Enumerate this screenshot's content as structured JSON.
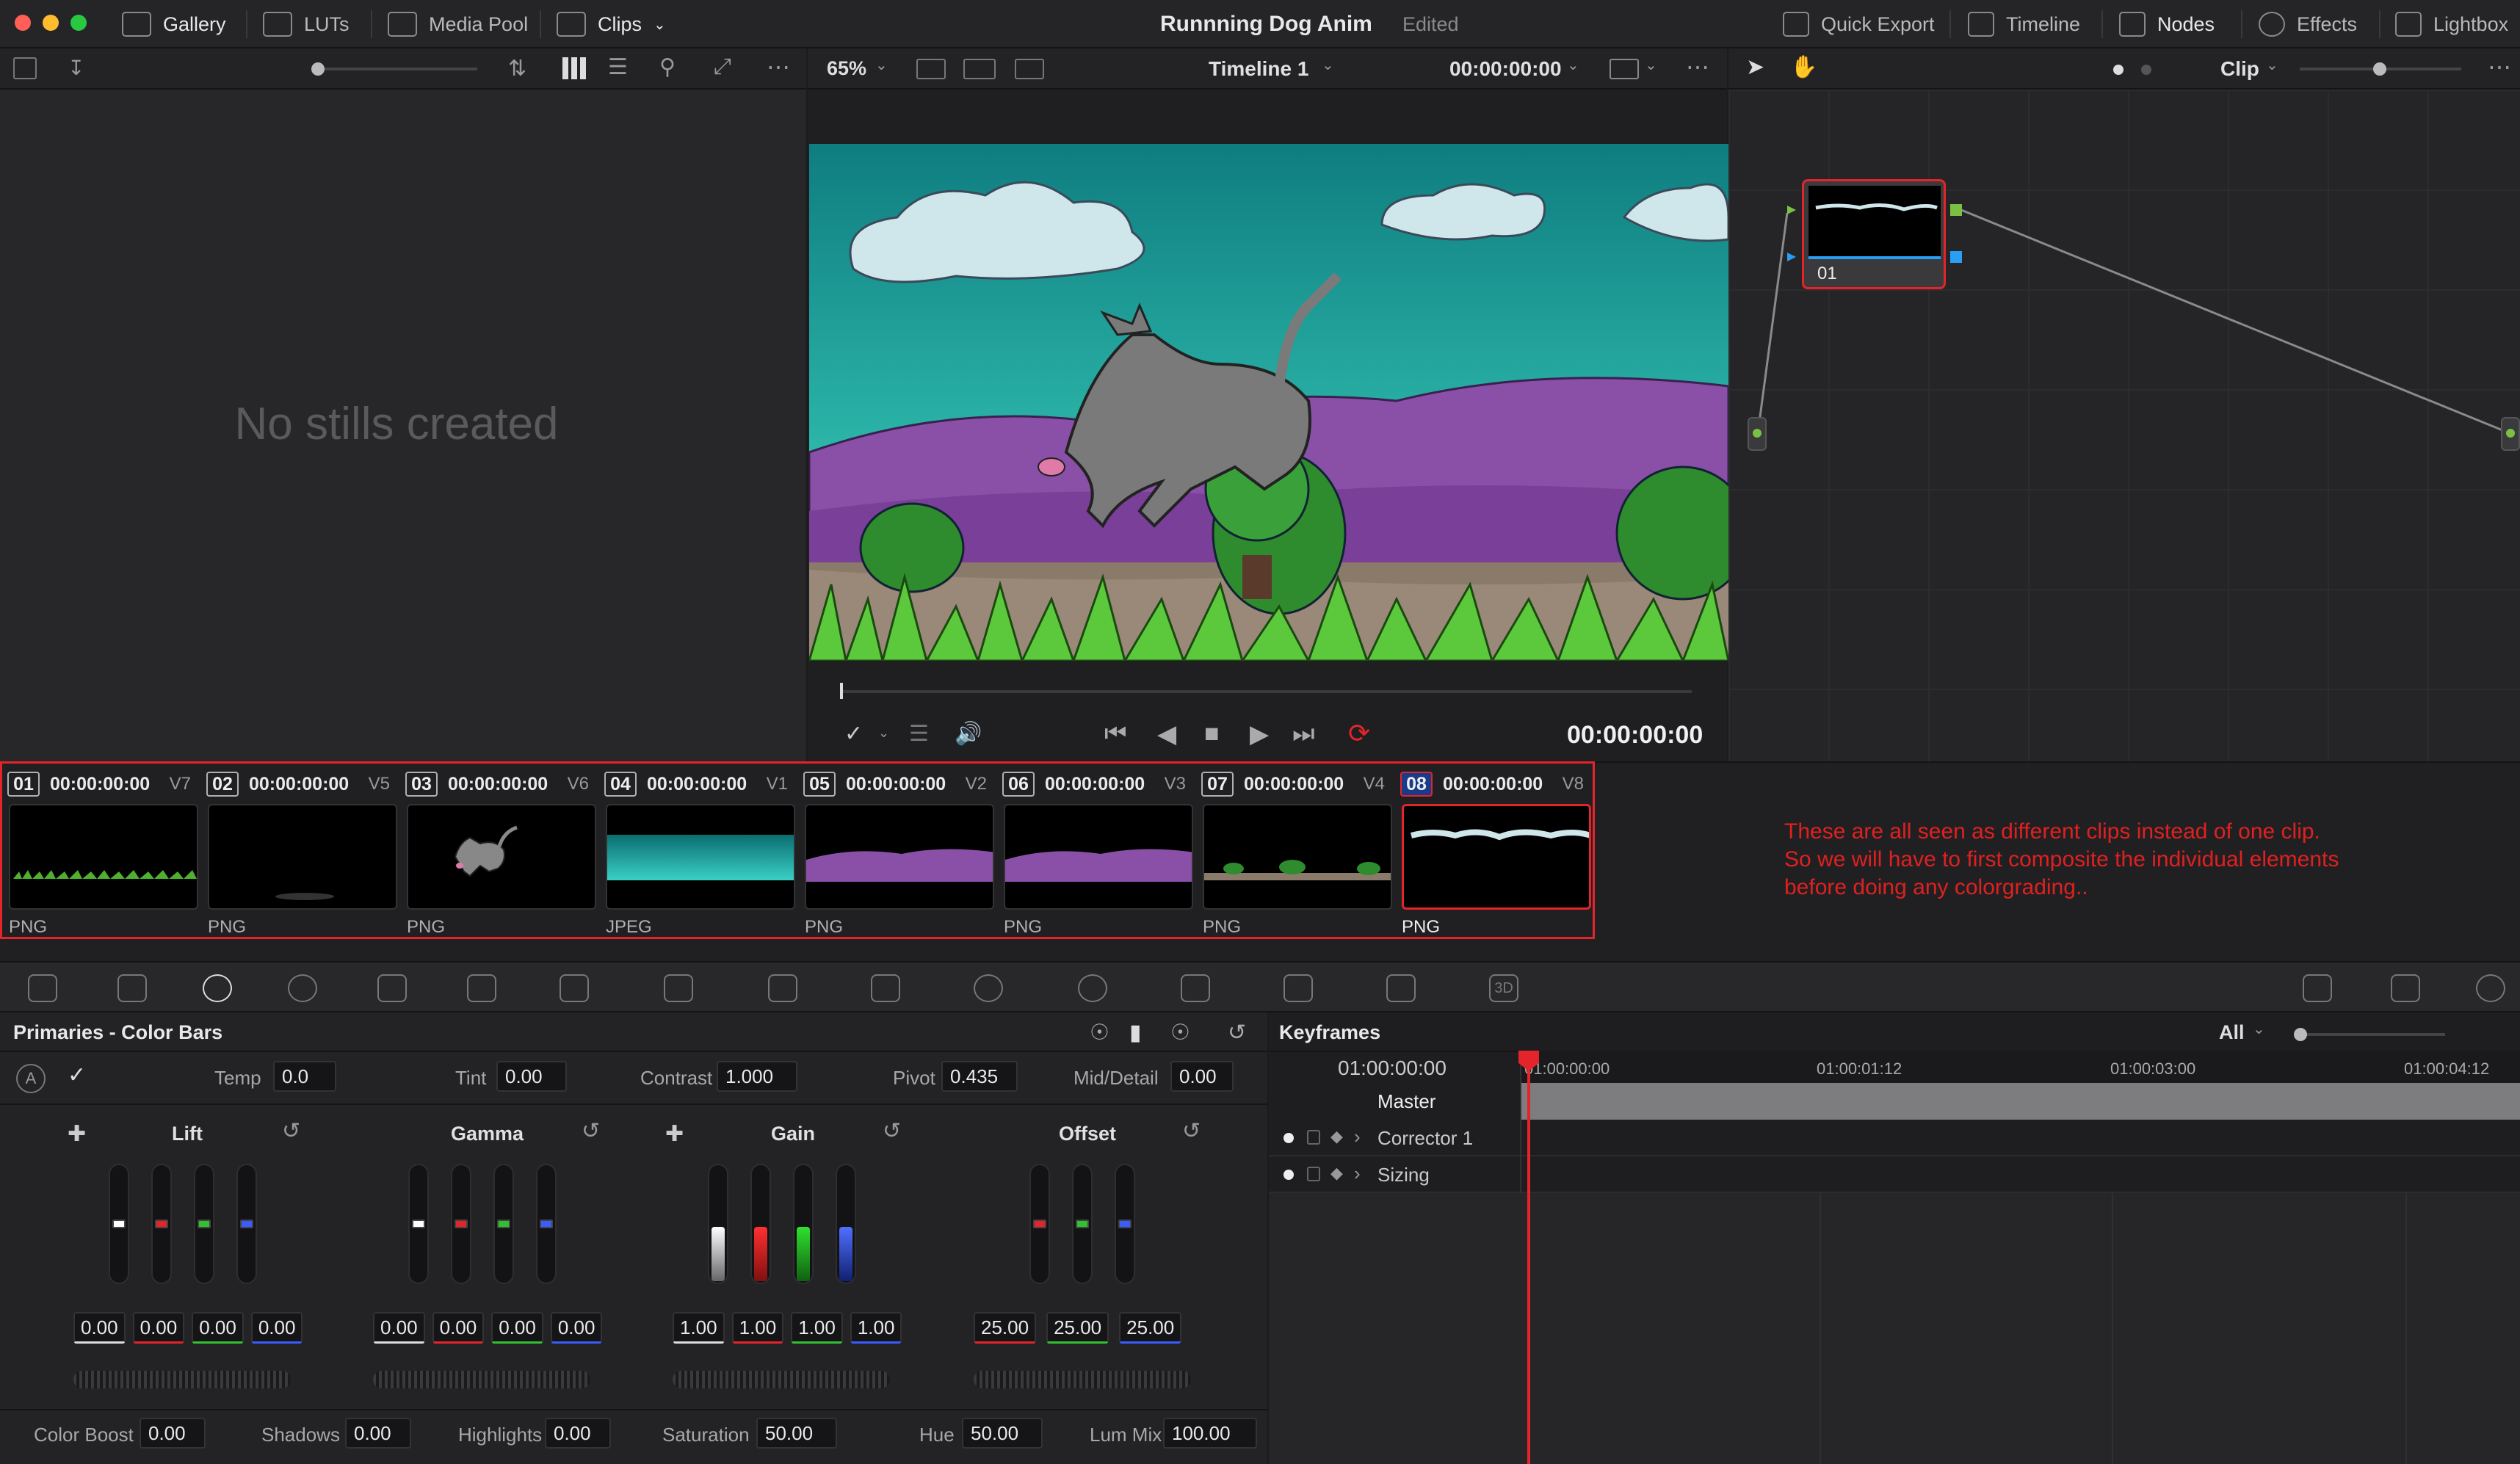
{
  "topbar": {
    "gallery": "Gallery",
    "luts": "LUTs",
    "media_pool": "Media Pool",
    "clips": "Clips",
    "project_title": "Runnning Dog Anim",
    "project_status": "Edited",
    "quick_export": "Quick Export",
    "timeline": "Timeline",
    "nodes": "Nodes",
    "effects": "Effects",
    "lightbox": "Lightbox"
  },
  "viewer_toolbar": {
    "zoom": "65%",
    "timeline_name": "Timeline 1",
    "timecode": "00:00:00:00",
    "playback_timecode": "00:00:00:00"
  },
  "node_toolbar": {
    "mode": "Clip"
  },
  "gallery": {
    "empty_message": "No stills created"
  },
  "node_editor": {
    "node_label": "01"
  },
  "clips": [
    {
      "num": "01",
      "tc": "00:00:00:00",
      "track": "V7",
      "format": "PNG",
      "thumb": "grass"
    },
    {
      "num": "02",
      "tc": "00:00:00:00",
      "track": "V5",
      "format": "PNG",
      "thumb": "shadow"
    },
    {
      "num": "03",
      "tc": "00:00:00:00",
      "track": "V6",
      "format": "PNG",
      "thumb": "dog"
    },
    {
      "num": "04",
      "tc": "00:00:00:00",
      "track": "V1",
      "format": "JPEG",
      "thumb": "sky"
    },
    {
      "num": "05",
      "tc": "00:00:00:00",
      "track": "V2",
      "format": "PNG",
      "thumb": "hills"
    },
    {
      "num": "06",
      "tc": "00:00:00:00",
      "track": "V3",
      "format": "PNG",
      "thumb": "hills"
    },
    {
      "num": "07",
      "tc": "00:00:00:00",
      "track": "V4",
      "format": "PNG",
      "thumb": "ground"
    },
    {
      "num": "08",
      "tc": "00:00:00:00",
      "track": "V8",
      "format": "PNG",
      "thumb": "clouds"
    }
  ],
  "annotation": {
    "line1": "These are all seen as different clips instead of one clip.",
    "line2": "So we will have to first composite the individual elements",
    "line3": "before doing any colorgrading.."
  },
  "primaries": {
    "title": "Primaries - Color Bars",
    "temp_label": "Temp",
    "temp": "0.0",
    "tint_label": "Tint",
    "tint": "0.00",
    "contrast_label": "Contrast",
    "contrast": "1.000",
    "pivot_label": "Pivot",
    "pivot": "0.435",
    "middetail_label": "Mid/Detail",
    "middetail": "0.00",
    "lift": {
      "title": "Lift",
      "values": [
        "0.00",
        "0.00",
        "0.00",
        "0.00"
      ]
    },
    "gamma": {
      "title": "Gamma",
      "values": [
        "0.00",
        "0.00",
        "0.00",
        "0.00"
      ]
    },
    "gain": {
      "title": "Gain",
      "values": [
        "1.00",
        "1.00",
        "1.00",
        "1.00"
      ]
    },
    "offset": {
      "title": "Offset",
      "values": [
        "25.00",
        "25.00",
        "25.00"
      ]
    },
    "colorboost_label": "Color Boost",
    "colorboost": "0.00",
    "shadows_label": "Shadows",
    "shadows": "0.00",
    "highlights_label": "Highlights",
    "highlights": "0.00",
    "saturation_label": "Saturation",
    "saturation": "50.00",
    "hue_label": "Hue",
    "hue": "50.00",
    "lummix_label": "Lum Mix",
    "lummix": "100.00"
  },
  "keyframes": {
    "title": "Keyframes",
    "filter": "All",
    "current_tc": "01:00:00:00",
    "ruler": [
      "01:00:00:00",
      "01:00:01:12",
      "01:00:03:00",
      "01:00:04:12"
    ],
    "master": "Master",
    "tracks": [
      "Corrector 1",
      "Sizing"
    ]
  },
  "colors": {
    "accent_red": "#e3242b",
    "annotation_red": "#e02020",
    "node_green": "#7ac143",
    "node_blue": "#2a9df4"
  }
}
